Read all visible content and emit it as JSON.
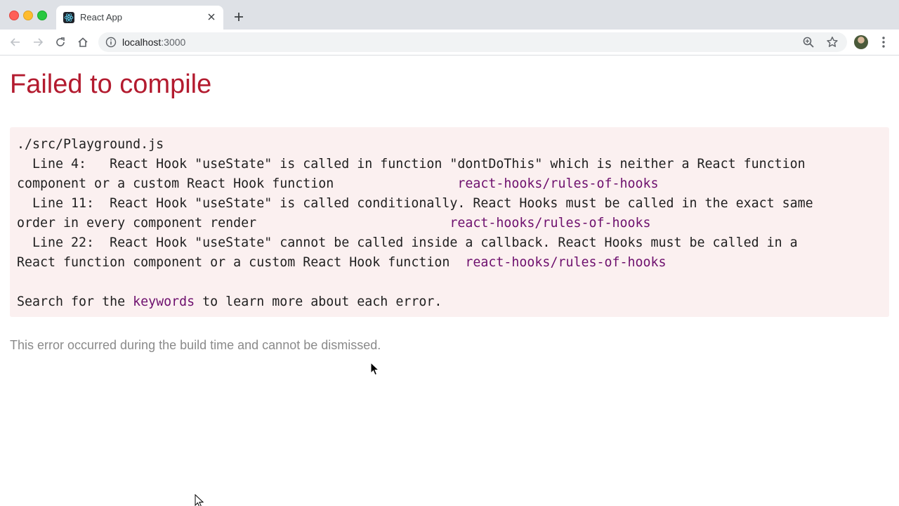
{
  "browser": {
    "tab_title": "React App",
    "url_host": "localhost",
    "url_port": ":3000"
  },
  "page": {
    "title": "Failed to compile",
    "file": "./src/Playground.js",
    "line1_a": "  Line 4:   React Hook \"useState\" is called in function \"dontDoThis\" which is neither a React function",
    "line1_b": "component or a custom React Hook function                ",
    "line2_a": "  Line 11:  React Hook \"useState\" is called conditionally. React Hooks must be called in the exact same",
    "line2_b": "order in every component render                         ",
    "line3_a": "  Line 22:  React Hook \"useState\" cannot be called inside a callback. React Hooks must be called in a",
    "line3_b": "React function component or a custom React Hook function  ",
    "rule_name": "react-hooks/rules-of-hooks",
    "search_prefix": "Search for the ",
    "search_keyword": "keywords",
    "search_suffix": " to learn more about each error.",
    "footer": "This error occurred during the build time and cannot be dismissed."
  },
  "colors": {
    "title_red": "#b31b2f",
    "box_bg": "#fbf0f0",
    "rule_purple": "#6d0f6d"
  }
}
